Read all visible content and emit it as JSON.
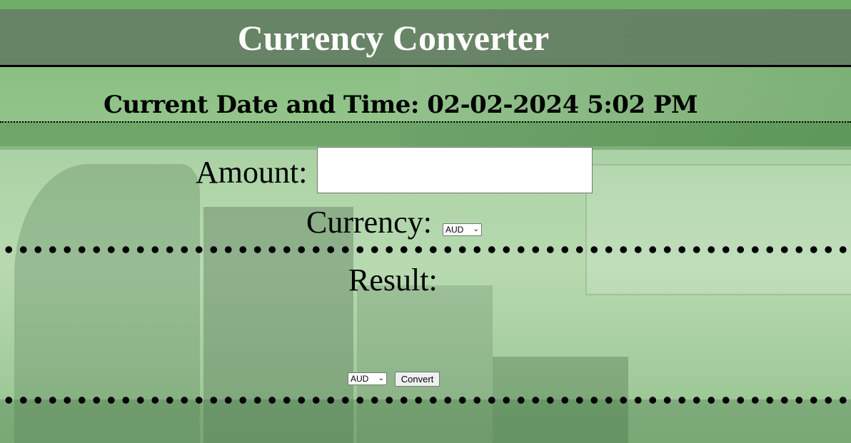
{
  "header": {
    "title": "Currency Converter"
  },
  "datetime": {
    "text": "Current Date and Time: 02-02-2024 5:02 PM"
  },
  "form": {
    "amount_label": "Amount:",
    "amount_value": "",
    "currency_label": "Currency:",
    "currency_selected": "AUD",
    "result_label": "Result:",
    "result_value": "",
    "target_currency_selected": "AUD",
    "convert_button": "Convert"
  },
  "colors": {
    "background_green": "#86bb7e",
    "header_band": "#607860",
    "title_text": "#ffffff"
  }
}
